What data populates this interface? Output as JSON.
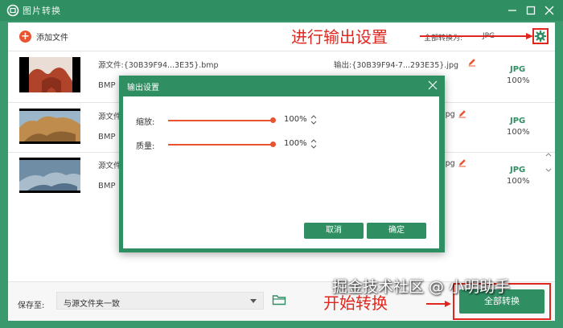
{
  "window": {
    "title": "图片转换"
  },
  "toolbar": {
    "add_file_label": "添加文件",
    "convert_all_label": "全部转换为:",
    "convert_all_format": "JPG"
  },
  "annotations": {
    "settings_hint": "进行输出设置",
    "start_hint": "开始转换"
  },
  "files": [
    {
      "source_label": "源文件:",
      "source_name": "{30B39F94...3E35}.bmp",
      "format": "BMP",
      "output_label": "输出:",
      "output_name": "{30B39F94-7...293E35}.jpg",
      "output_format": "JPG",
      "quality": "100%"
    },
    {
      "source_label": "源文件",
      "source_name": "",
      "format": "BMP",
      "output_label": "",
      "output_name": "jpg",
      "output_format": "JPG",
      "quality": "100%"
    },
    {
      "source_label": "源文件",
      "source_name": "",
      "format": "BMP",
      "output_label": "",
      "output_name": "jpg",
      "output_format": "JPG",
      "quality": "100%"
    }
  ],
  "dialog": {
    "title": "输出设置",
    "scale_label": "缩放:",
    "scale_value": "100%",
    "scale_fraction": 1.0,
    "quality_label": "质量:",
    "quality_value": "100%",
    "quality_fraction": 1.0,
    "cancel_label": "取消",
    "confirm_label": "确定"
  },
  "bottom": {
    "save_to_label": "保存至:",
    "save_to_value": "与源文件夹一致",
    "start_label": "全部转换"
  },
  "watermark": "掘金技术社区 @ 小明助手",
  "colors": {
    "brand_green": "#2f8f63",
    "accent_orange": "#e8542f",
    "annotation_red": "#e0271f"
  }
}
